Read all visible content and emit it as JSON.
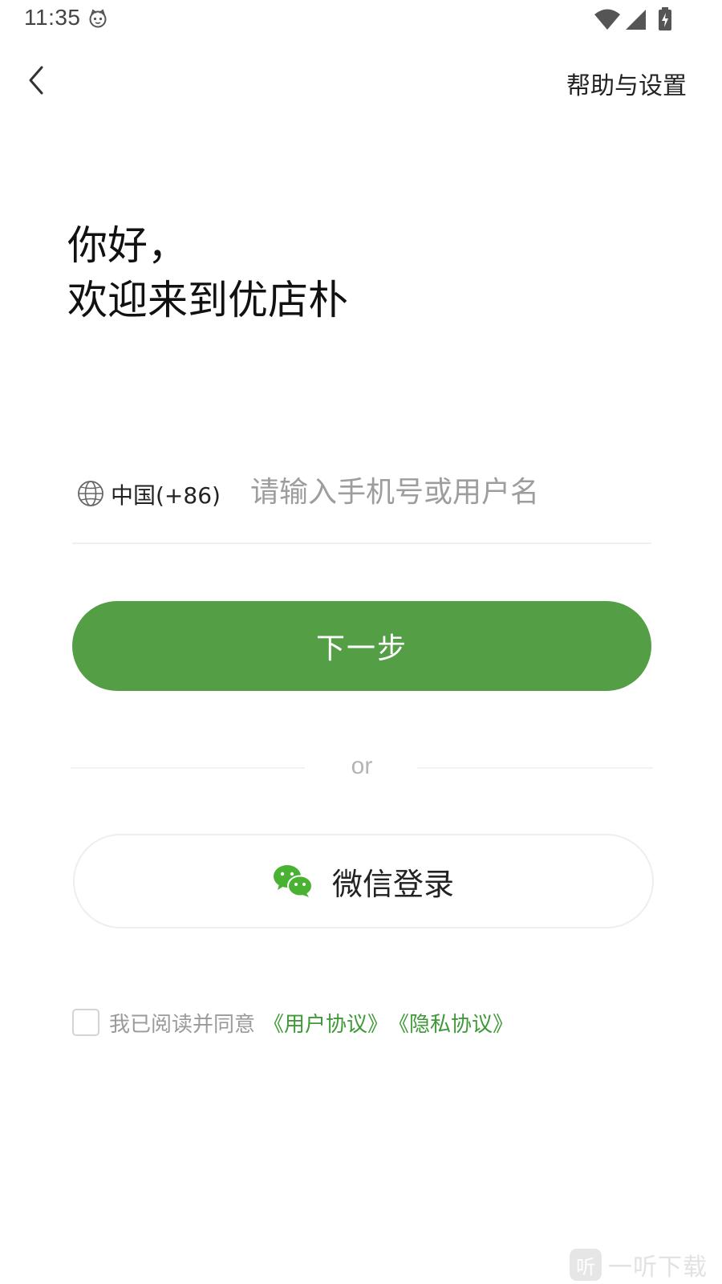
{
  "status_bar": {
    "time": "11:35",
    "icons": [
      "cat-notification-icon",
      "wifi-icon",
      "cell-signal-icon",
      "battery-charging-icon"
    ]
  },
  "header": {
    "back_icon": "chevron-left-icon",
    "help_label": "帮助与设置"
  },
  "greeting": {
    "line1": "你好，",
    "line2": "欢迎来到优店朴"
  },
  "login_form": {
    "country_icon": "globe-icon",
    "country_code": "中国(+86)",
    "phone_placeholder": "请输入手机号或用户名",
    "phone_value": "",
    "next_label": "下一步"
  },
  "divider_text": "or",
  "wechat": {
    "icon": "wechat-icon",
    "label": "微信登录"
  },
  "agreement": {
    "checked": false,
    "text": "我已阅读并同意",
    "user_agreement": "《用户协议》",
    "privacy_agreement": "《隐私协议》"
  },
  "watermark": {
    "badge": "听",
    "text": "一听下载"
  },
  "colors": {
    "primary_green": "#549f46",
    "link_green": "#3d9a36",
    "placeholder_gray": "#9d9d9d"
  }
}
